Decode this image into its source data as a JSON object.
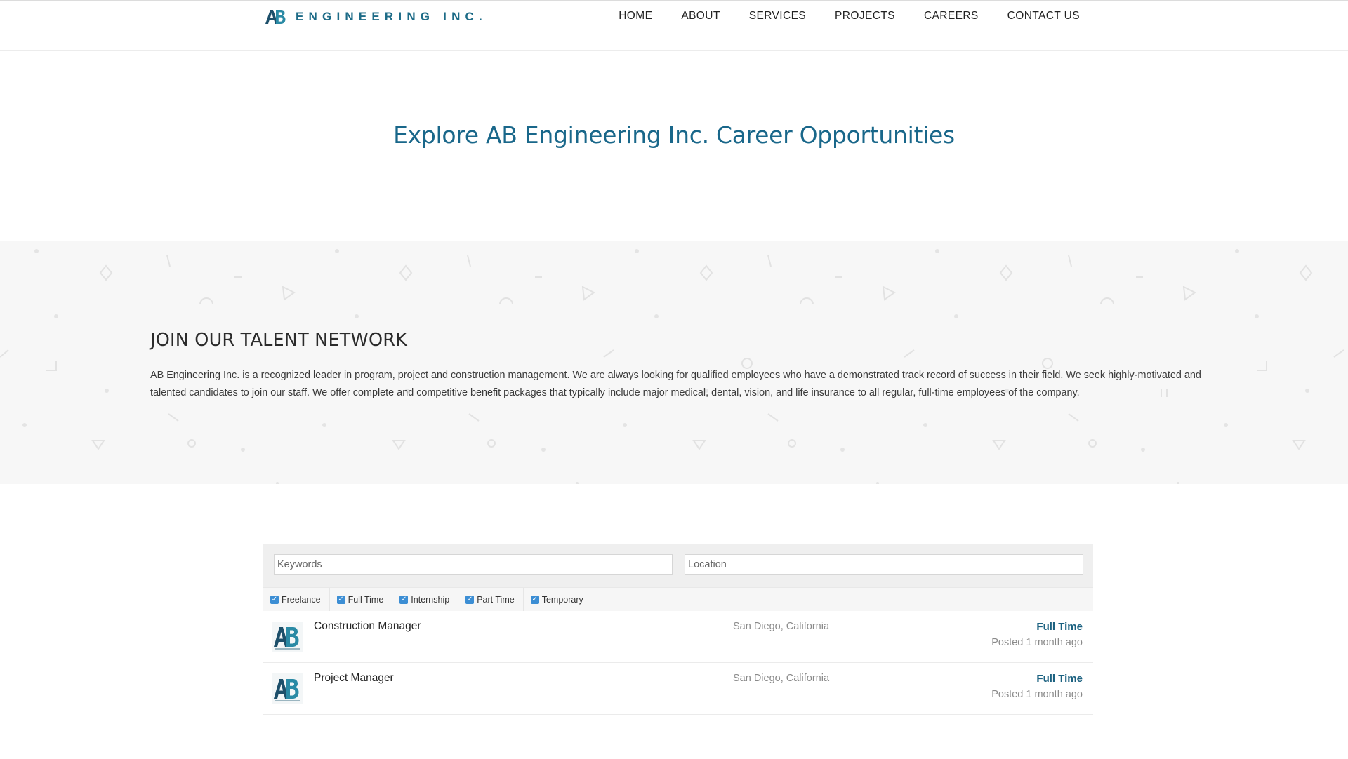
{
  "header": {
    "logo_text": "ENGINEERING INC.",
    "logo_mark": "AB",
    "nav": [
      "HOME",
      "ABOUT",
      "SERVICES",
      "PROJECTS",
      "CAREERS",
      "CONTACT US"
    ]
  },
  "hero": {
    "title": "Explore AB Engineering Inc. Career Opportunities"
  },
  "talent": {
    "heading": "JOIN OUR TALENT NETWORK",
    "body": "AB Engineering Inc. is a recognized leader in program, project and construction management. We are always looking for qualified employees who have a demonstrated track record of success in their field. We seek highly-motivated and talented candidates to join our staff. We offer complete and competitive benefit packages that typically include major medical, dental, vision, and life insurance to all regular, full-time employees of the company."
  },
  "search": {
    "keywords_placeholder": "Keywords",
    "location_placeholder": "Location"
  },
  "filters": [
    {
      "label": "Freelance",
      "checked": true
    },
    {
      "label": "Full Time",
      "checked": true
    },
    {
      "label": "Internship",
      "checked": true
    },
    {
      "label": "Part Time",
      "checked": true
    },
    {
      "label": "Temporary",
      "checked": true
    }
  ],
  "jobs": [
    {
      "title": "Construction Manager",
      "location": "San Diego, California",
      "type": "Full Time",
      "posted": "Posted 1 month ago"
    },
    {
      "title": "Project Manager",
      "location": "San Diego, California",
      "type": "Full Time",
      "posted": "Posted 1 month ago"
    }
  ],
  "colors": {
    "brand": "#1d6b87",
    "title": "#19678a",
    "checkbox": "#3c8ed4",
    "band_bg": "#f7f7f7"
  }
}
